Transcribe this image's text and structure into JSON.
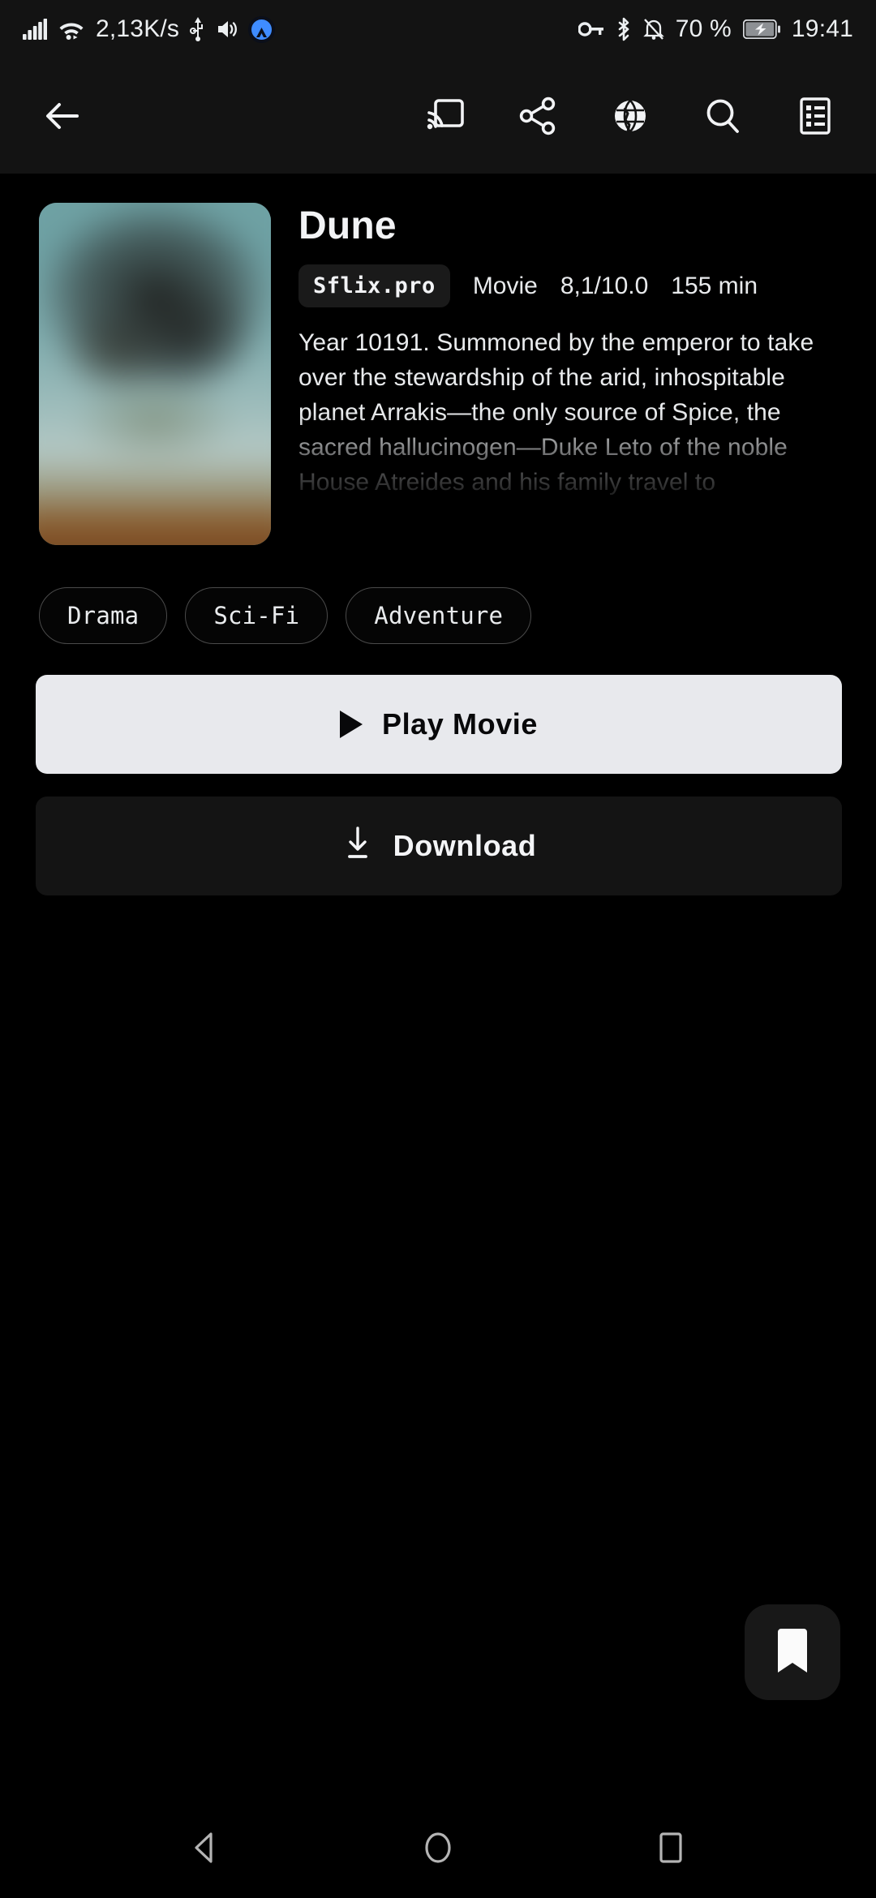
{
  "status_bar": {
    "network_speed": "2,13K/s",
    "battery_percent": "70 %",
    "clock": "19:41",
    "icons": [
      "signal-bars-icon",
      "wifi-icon",
      "usb-icon",
      "volume-icon",
      "nordvpn-icon",
      "vpn-key-icon",
      "bluetooth-icon",
      "notifications-muted-icon",
      "battery-charging-icon"
    ]
  },
  "app_bar": {
    "back_icon": "back-arrow-icon",
    "actions": [
      {
        "name": "cast-icon",
        "label": "Cast"
      },
      {
        "name": "share-icon",
        "label": "Share"
      },
      {
        "name": "globe-icon",
        "label": "Open in browser"
      },
      {
        "name": "search-icon",
        "label": "Search"
      },
      {
        "name": "list-icon",
        "label": "Episodes list"
      }
    ]
  },
  "detail": {
    "title": "Dune",
    "source_badge": "Sflix.pro",
    "type": "Movie",
    "rating": "8,1/10.0",
    "duration": "155 min",
    "description": "Year 10191. Summoned by the emperor to take over the stewardship of the arid, inhospitable planet Arrakis—the only source of Spice, the sacred hallucinogen—Duke Leto of the noble House Atreides and his family travel to",
    "genres": [
      "Drama",
      "Sci-Fi",
      "Adventure"
    ]
  },
  "buttons": {
    "play": {
      "label": "Play Movie",
      "icon": "play-triangle-icon"
    },
    "download": {
      "label": "Download",
      "icon": "download-arrow-icon"
    }
  },
  "fab": {
    "icon": "bookmark-icon"
  },
  "nav_bar": {
    "back": "nav-back-triangle-icon",
    "home": "nav-home-circle-icon",
    "recents": "nav-recents-square-icon"
  },
  "colors": {
    "background": "#000000",
    "app_bar": "#131313",
    "play_button": "#e8e9ed",
    "download_button": "#141414",
    "text_primary": "#f2f3f5",
    "chip_border": "#4a4a4a",
    "nav_icon": "#b4b4b4"
  }
}
